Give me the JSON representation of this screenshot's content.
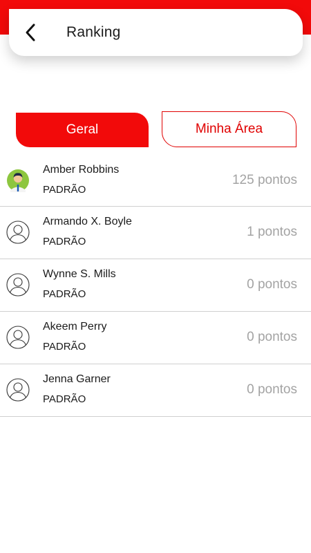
{
  "header": {
    "title": "Ranking",
    "back_icon": "chevron-left-icon"
  },
  "tabs": [
    {
      "label": "Geral",
      "active": true
    },
    {
      "label": "Minha Área",
      "active": false
    }
  ],
  "colors": {
    "accent": "#f20a0a",
    "points_text": "#a3a3a3",
    "divider": "#cfcfcf"
  },
  "ranking": [
    {
      "name": "Amber Robbins",
      "level": "PADRÃO",
      "points": "125 pontos",
      "avatar": "user-photo-avatar"
    },
    {
      "name": "Armando X. Boyle",
      "level": "PADRÃO",
      "points": "1 pontos",
      "avatar": "user-outline-avatar"
    },
    {
      "name": "Wynne S. Mills",
      "level": "PADRÃO",
      "points": "0 pontos",
      "avatar": "user-outline-avatar"
    },
    {
      "name": "Akeem Perry",
      "level": "PADRÃO",
      "points": "0 pontos",
      "avatar": "user-outline-avatar"
    },
    {
      "name": "Jenna Garner",
      "level": "PADRÃO",
      "points": "0 pontos",
      "avatar": "user-outline-avatar"
    }
  ]
}
